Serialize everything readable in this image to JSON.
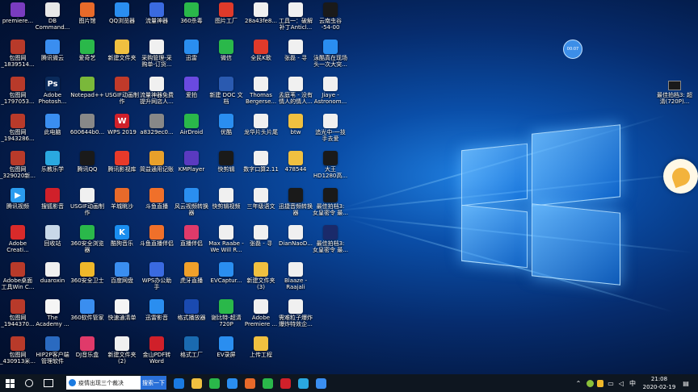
{
  "desktop_icons": [
    {
      "label": "premiere...",
      "color": "#7a3cc0",
      "glyph": "",
      "col": 0,
      "row": 0
    },
    {
      "label": "包图网\n_1839514...",
      "color": "#b83a2a",
      "glyph": "",
      "col": 0,
      "row": 1
    },
    {
      "label": "包图网\n_1797053...",
      "color": "#b83a2a",
      "glyph": "",
      "col": 0,
      "row": 2
    },
    {
      "label": "包图网\n_1943286...",
      "color": "#b83a2a",
      "glyph": "",
      "col": 0,
      "row": 3
    },
    {
      "label": "包图网\n_329020新...",
      "color": "#b83a2a",
      "glyph": "",
      "col": 0,
      "row": 4
    },
    {
      "label": "腾讯视频",
      "color": "#2a9cf0",
      "glyph": "▶",
      "col": 0,
      "row": 5
    },
    {
      "label": "Adobe\nCreati...",
      "color": "#d92a2a",
      "glyph": "",
      "col": 0,
      "row": 6
    },
    {
      "label": "Adobe桌面\n工具Win C...",
      "color": "#b83a2a",
      "glyph": "",
      "col": 0,
      "row": 7
    },
    {
      "label": "包图网\n_1944370...",
      "color": "#b83a2a",
      "glyph": "",
      "col": 0,
      "row": 8
    },
    {
      "label": "包图网\n_430913米...",
      "color": "#b83a2a",
      "glyph": "",
      "col": 0,
      "row": 9
    },
    {
      "label": "DB\nCommand...",
      "color": "#e8e8e8",
      "glyph": "",
      "col": 1,
      "row": 0
    },
    {
      "label": "腾讯微云",
      "color": "#3a8ef0",
      "glyph": "",
      "col": 1,
      "row": 1
    },
    {
      "label": "Adobe\nPhotosh...",
      "color": "#0a2a5a",
      "glyph": "Ps",
      "col": 1,
      "row": 2
    },
    {
      "label": "此电脑",
      "color": "#3a8ef0",
      "glyph": "",
      "col": 1,
      "row": 3
    },
    {
      "label": "乐教乐学",
      "color": "#2aa8e0",
      "glyph": "",
      "col": 1,
      "row": 4
    },
    {
      "label": "搜狐影音",
      "color": "#d0202a",
      "glyph": "",
      "col": 1,
      "row": 5
    },
    {
      "label": "回收站",
      "color": "#c8d8e8",
      "glyph": "",
      "col": 1,
      "row": 6
    },
    {
      "label": "duaroxin",
      "color": "#f0f0f0",
      "glyph": "",
      "col": 1,
      "row": 7
    },
    {
      "label": "The\nAcademy ...",
      "color": "#f5f5f5",
      "glyph": "",
      "col": 1,
      "row": 8
    },
    {
      "label": "HIP2P客户端\n管理软件",
      "color": "#2a6ac0",
      "glyph": "",
      "col": 1,
      "row": 9
    },
    {
      "label": "图片馆",
      "color": "#e86a2a",
      "glyph": "",
      "col": 2,
      "row": 0
    },
    {
      "label": "爱奇艺",
      "color": "#2ab84a",
      "glyph": "",
      "col": 2,
      "row": 1
    },
    {
      "label": "Notepad++",
      "color": "#7ab83a",
      "glyph": "",
      "col": 2,
      "row": 2
    },
    {
      "label": "600644b0...",
      "color": "#888888",
      "glyph": "",
      "col": 2,
      "row": 3
    },
    {
      "label": "腾讯QQ",
      "color": "#1a1a1a",
      "glyph": "",
      "col": 2,
      "row": 4
    },
    {
      "label": "USGIF动画制\n作",
      "color": "#f0f0f0",
      "glyph": "",
      "col": 2,
      "row": 5
    },
    {
      "label": "360安全浏览\n器",
      "color": "#2ab84a",
      "glyph": "",
      "col": 2,
      "row": 6
    },
    {
      "label": "360安全卫士",
      "color": "#f0b82a",
      "glyph": "",
      "col": 2,
      "row": 7
    },
    {
      "label": "360软件管家",
      "color": "#3a8ef0",
      "glyph": "",
      "col": 2,
      "row": 8
    },
    {
      "label": "DJ音乐盒",
      "color": "#e03a6a",
      "glyph": "",
      "col": 2,
      "row": 9
    },
    {
      "label": "QQ浏览器",
      "color": "#2a8ef0",
      "glyph": "",
      "col": 3,
      "row": 0
    },
    {
      "label": "新建文件夹",
      "color": "#f0c040",
      "glyph": "",
      "col": 3,
      "row": 1
    },
    {
      "label": "USGIF动画制\n作",
      "color": "#c03a2a",
      "glyph": "",
      "col": 3,
      "row": 2
    },
    {
      "label": "WPS 2019",
      "color": "#d0202a",
      "glyph": "W",
      "col": 3,
      "row": 3
    },
    {
      "label": "腾讯影视库",
      "color": "#e83a2a",
      "glyph": "",
      "col": 3,
      "row": 4
    },
    {
      "label": "羊城眺沙",
      "color": "#e86a2a",
      "glyph": "",
      "col": 3,
      "row": 5
    },
    {
      "label": "酷狗音乐",
      "color": "#1a8ef0",
      "glyph": "K",
      "col": 3,
      "row": 6
    },
    {
      "label": "百度网盘",
      "color": "#3a8ef0",
      "glyph": "",
      "col": 3,
      "row": 7
    },
    {
      "label": "快速通清单",
      "color": "#f5f5f5",
      "glyph": "",
      "col": 3,
      "row": 8
    },
    {
      "label": "新建文件夹\n(2)",
      "color": "#f0f0f0",
      "glyph": "",
      "col": 3,
      "row": 9
    },
    {
      "label": "流量神器",
      "color": "#3a6ae0",
      "glyph": "",
      "col": 4,
      "row": 0
    },
    {
      "label": "采购管理-采\n购单-订货...",
      "color": "#f0f0f0",
      "glyph": "",
      "col": 4,
      "row": 1
    },
    {
      "label": "流量神器免费\n提升网店人...",
      "color": "#f0f0f0",
      "glyph": "",
      "col": 4,
      "row": 2
    },
    {
      "label": "a8329ec0...",
      "color": "#888888",
      "glyph": "",
      "col": 4,
      "row": 3
    },
    {
      "label": "简益通用记账",
      "color": "#e8a02a",
      "glyph": "",
      "col": 4,
      "row": 4
    },
    {
      "label": "斗鱼直播",
      "color": "#f0702a",
      "glyph": "",
      "col": 4,
      "row": 5
    },
    {
      "label": "斗鱼直播伴侣",
      "color": "#f0702a",
      "glyph": "",
      "col": 4,
      "row": 6
    },
    {
      "label": "WPS办公助\n手",
      "color": "#3a6ae0",
      "glyph": "",
      "col": 4,
      "row": 7
    },
    {
      "label": "迅雷影音",
      "color": "#2a8ef0",
      "glyph": "",
      "col": 4,
      "row": 8
    },
    {
      "label": "金山PDF转\nWord",
      "color": "#d0202a",
      "glyph": "",
      "col": 4,
      "row": 9
    },
    {
      "label": "360杀毒",
      "color": "#2ab84a",
      "glyph": "",
      "col": 5,
      "row": 0
    },
    {
      "label": "迅雷",
      "color": "#2a8ef0",
      "glyph": "",
      "col": 5,
      "row": 1
    },
    {
      "label": "爱拍",
      "color": "#6a4ae0",
      "glyph": "",
      "col": 5,
      "row": 2
    },
    {
      "label": "AirDroid",
      "color": "#2ab84a",
      "glyph": "",
      "col": 5,
      "row": 3
    },
    {
      "label": "KMPlayer",
      "color": "#5a3ac0",
      "glyph": "",
      "col": 5,
      "row": 4
    },
    {
      "label": "风云视频转换\n器",
      "color": "#2a8ef0",
      "glyph": "",
      "col": 5,
      "row": 5
    },
    {
      "label": "直播伴侣",
      "color": "#e03a6a",
      "glyph": "",
      "col": 5,
      "row": 6
    },
    {
      "label": "虎牙直播",
      "color": "#f0a02a",
      "glyph": "",
      "col": 5,
      "row": 7
    },
    {
      "label": "格式播放器",
      "color": "#1a4ab0",
      "glyph": "",
      "col": 5,
      "row": 8
    },
    {
      "label": "格式工厂",
      "color": "#1a6ab0",
      "glyph": "",
      "col": 5,
      "row": 9
    },
    {
      "label": "图片工厂",
      "color": "#e03a2a",
      "glyph": "",
      "col": 6,
      "row": 0
    },
    {
      "label": "微信",
      "color": "#2ab84a",
      "glyph": "",
      "col": 6,
      "row": 1
    },
    {
      "label": "新建 DOC 文\n档",
      "color": "#2a5ab0",
      "glyph": "",
      "col": 6,
      "row": 2
    },
    {
      "label": "优酷",
      "color": "#2a8ef0",
      "glyph": "",
      "col": 6,
      "row": 3
    },
    {
      "label": "快剪辑",
      "color": "#1a1a1a",
      "glyph": "",
      "col": 6,
      "row": 4
    },
    {
      "label": "快剪辑视频",
      "color": "#f0f0f0",
      "glyph": "",
      "col": 6,
      "row": 5
    },
    {
      "label": "Max Raabe -\nWe Will R...",
      "color": "#f0f0f0",
      "glyph": "",
      "col": 6,
      "row": 6
    },
    {
      "label": "EVCaptur...",
      "color": "#2a8ef0",
      "glyph": "",
      "col": 6,
      "row": 7
    },
    {
      "label": "谢比特-超清\n720P",
      "color": "#2ab84a",
      "glyph": "",
      "col": 6,
      "row": 8
    },
    {
      "label": "EV录屏",
      "color": "#2a8ef0",
      "glyph": "",
      "col": 6,
      "row": 9
    },
    {
      "label": "28a43fe8...",
      "color": "#f0f0f0",
      "glyph": "",
      "col": 7,
      "row": 0
    },
    {
      "label": "全民K歌",
      "color": "#e03a2a",
      "glyph": "",
      "col": 7,
      "row": 1
    },
    {
      "label": "Thomas\nBergerse...",
      "color": "#f0f0f0",
      "glyph": "",
      "col": 7,
      "row": 2
    },
    {
      "label": "龙华片头片尾",
      "color": "#f0f0f0",
      "glyph": "",
      "col": 7,
      "row": 3
    },
    {
      "label": "数字口算2.11",
      "color": "#f0f0f0",
      "glyph": "",
      "col": 7,
      "row": 4
    },
    {
      "label": "三年级语文",
      "color": "#f0f0f0",
      "glyph": "",
      "col": 7,
      "row": 5
    },
    {
      "label": "张磊 - 寻",
      "color": "#f0f0f0",
      "glyph": "",
      "col": 7,
      "row": 6
    },
    {
      "label": "新建文件夹\n(3)",
      "color": "#f0c040",
      "glyph": "",
      "col": 7,
      "row": 7
    },
    {
      "label": "Adobe\nPremiere ...",
      "color": "#f0f0f0",
      "glyph": "",
      "col": 7,
      "row": 8
    },
    {
      "label": "上传工程",
      "color": "#f0c040",
      "glyph": "",
      "col": 7,
      "row": 9
    },
    {
      "label": "工具一：破解\n补丁Anticl...",
      "color": "#f0f0f0",
      "glyph": "",
      "col": 8,
      "row": 0
    },
    {
      "label": "张磊 - 寻",
      "color": "#f0f0f0",
      "glyph": "",
      "col": 8,
      "row": 1
    },
    {
      "label": "孟庭苇 - 没有\n情人的情人...",
      "color": "#f0f0f0",
      "glyph": "",
      "col": 8,
      "row": 2
    },
    {
      "label": "btw",
      "color": "#f0c040",
      "glyph": "",
      "col": 8,
      "row": 3
    },
    {
      "label": "478544",
      "color": "#f0c040",
      "glyph": "",
      "col": 8,
      "row": 4
    },
    {
      "label": "迅捷音频转换\n器",
      "color": "#1a1a1a",
      "glyph": "",
      "col": 8,
      "row": 5
    },
    {
      "label": "DianNaoD...",
      "color": "#f0f0f0",
      "glyph": "",
      "col": 8,
      "row": 6
    },
    {
      "label": "Blaaze -\nRaajali",
      "color": "#f0f0f0",
      "glyph": "",
      "col": 8,
      "row": 7
    },
    {
      "label": "需难粒子爆炸\n爆炸特效企...",
      "color": "#f0f0f0",
      "glyph": "",
      "col": 8,
      "row": 8
    },
    {
      "label": "云南虫谷\n-54-00",
      "color": "#1a1a1a",
      "glyph": "",
      "col": 9,
      "row": 0
    },
    {
      "label": "泳酷真在现场\n头一次大突...",
      "color": "#2a8ef0",
      "glyph": "",
      "col": 9,
      "row": 1
    },
    {
      "label": "Jiaye -\nAstronom...",
      "color": "#f0f0f0",
      "glyph": "",
      "col": 9,
      "row": 2
    },
    {
      "label": "追光中-一技\n手去爱",
      "color": "#f0f0f0",
      "glyph": "",
      "col": 9,
      "row": 3
    },
    {
      "label": "大王\nHD1280高...",
      "color": "#1a1a1a",
      "glyph": "",
      "col": 9,
      "row": 4
    },
    {
      "label": "最佳拍档3:\n女皇密令 最...",
      "color": "#1a1a1a",
      "glyph": "",
      "col": 9,
      "row": 5
    },
    {
      "label": "最佳拍档3:\n女皇密令 最...",
      "color": "#1a2a6a",
      "glyph": "",
      "col": 9,
      "row": 6
    }
  ],
  "right_widget": {
    "label": "最佳拍档3: 超清(720P)..."
  },
  "float_ball": {
    "label": "00:07"
  },
  "taskbar": {
    "search_text": "疫情出现三个裁决",
    "search_button": "搜索一下",
    "time": "21:08",
    "date": "2020-02-19",
    "ime": "中"
  },
  "colors": {
    "taskbar_bg": "#0e1620",
    "accent": "#2a70d8"
  }
}
